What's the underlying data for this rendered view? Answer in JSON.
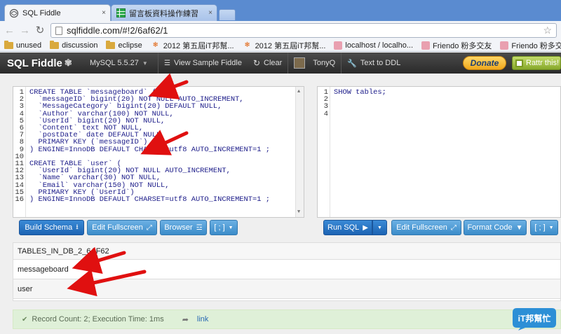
{
  "browser": {
    "tabs": [
      {
        "title": "SQL Fiddle",
        "close": "×",
        "active": true
      },
      {
        "title": "留言板資料操作練習",
        "close": "×",
        "active": false
      }
    ],
    "address": {
      "url": "sqlfiddle.com/#!2/6af62/1"
    },
    "bookmarks": [
      {
        "label": "unused",
        "icon": "folder"
      },
      {
        "label": "discussion",
        "icon": "folder"
      },
      {
        "label": "eclipse",
        "icon": "folder"
      },
      {
        "label": "2012 第五屆iT邦幫...",
        "icon": "ithome"
      },
      {
        "label": "2012 第五屆iT邦幫...",
        "icon": "ithome"
      },
      {
        "label": "localhost / localho...",
        "icon": "phpmyadmin"
      },
      {
        "label": "Friendo 粉多交友",
        "icon": "phpmyadmin"
      },
      {
        "label": "Friendo 粉多交友",
        "icon": "phpmyadmin"
      }
    ]
  },
  "app": {
    "brand": "SQL Fiddle",
    "db_version": "MySQL 5.5.27",
    "view_sample": "View Sample Fiddle",
    "clear": "Clear",
    "user": "TonyQ",
    "text_to_ddl": "Text to DDL",
    "donate": "Donate",
    "rattr": "Rattr this!"
  },
  "schema_editor": {
    "line_count": 16,
    "lines": [
      "CREATE TABLE `messageboard` (",
      "  `messageID` bigint(20) NOT NULL AUTO_INCREMENT,",
      "  `MessageCategory` bigint(20) DEFAULT NULL,",
      "  `Author` varchar(100) NOT NULL,",
      "  `UserId` bigint(20) NOT NULL,",
      "  `Content` text NOT NULL,",
      "  `postDate` date DEFAULT NULL,",
      "  PRIMARY KEY (`messageID`)",
      ") ENGINE=InnoDB DEFAULT CHARSET=utf8 AUTO_INCREMENT=1 ;",
      "",
      "CREATE TABLE `user` (",
      "  `UserId` bigint(20) NOT NULL AUTO_INCREMENT,",
      "  `Name` varchar(30) NOT NULL,",
      "  `Email` varchar(150) NOT NULL,",
      "  PRIMARY KEY (`UserId`)",
      ") ENGINE=InnoDB DEFAULT CHARSET=utf8 AUTO_INCREMENT=1 ;"
    ]
  },
  "query_editor": {
    "line_numbers": [
      "1",
      "2",
      "3",
      "4"
    ],
    "lines": [
      "SHOW tables;",
      "",
      "",
      ""
    ]
  },
  "left_buttons": {
    "build_schema": "Build Schema",
    "edit_fullscreen": "Edit Fullscreen",
    "browser": "Browser",
    "terminator": "[ ; ]"
  },
  "right_buttons": {
    "run_sql": "Run SQL",
    "edit_fullscreen": "Edit Fullscreen",
    "format_code": "Format Code",
    "terminator": "[ ; ]"
  },
  "results": {
    "header": "TABLES_IN_DB_2_6AF62",
    "rows": [
      "messageboard",
      "user"
    ]
  },
  "status": {
    "text": "Record Count: 2; Execution Time: 1ms",
    "link": "link"
  },
  "watermark": {
    "text": "iT邦幫忙"
  },
  "colors": {
    "accent_blue": "#1c63b3",
    "light_blue": "#3b8cc9",
    "annotation_red": "#e01010",
    "status_green": "#dff0d8"
  }
}
